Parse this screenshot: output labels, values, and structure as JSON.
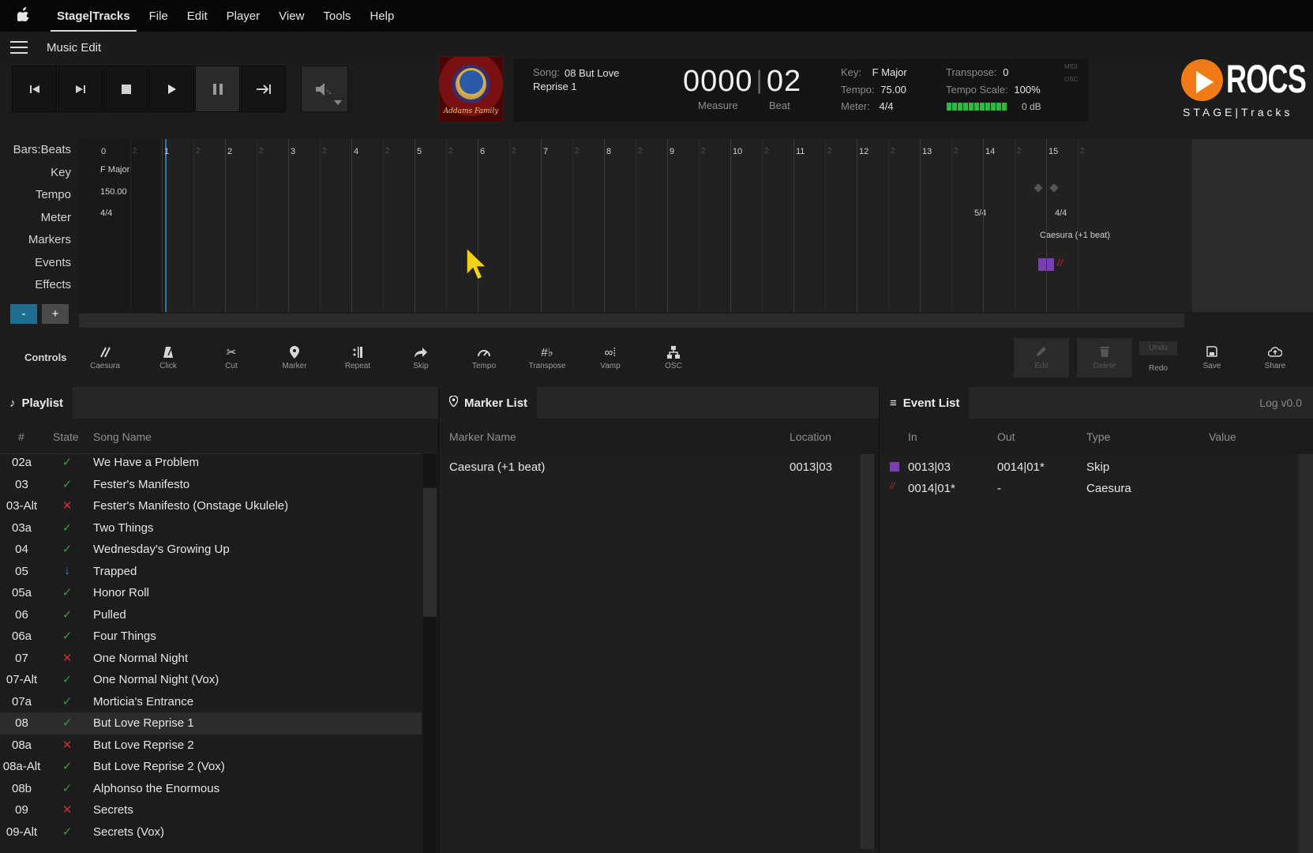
{
  "menubar": {
    "apple": "",
    "app_name": "Stage|Tracks",
    "items": [
      "File",
      "Edit",
      "Player",
      "View",
      "Tools",
      "Help"
    ]
  },
  "titlebar": {
    "title": "Music Edit"
  },
  "album": {
    "script_text": "Addams Family"
  },
  "info": {
    "song_label": "Song:",
    "song_name": "08 But Love Reprise 1",
    "measure": "0000",
    "beat": "02",
    "measure_label": "Measure",
    "beat_label": "Beat",
    "key_label": "Key:",
    "key": "F Major",
    "tempo_label": "Tempo:",
    "tempo": "75.00",
    "meter_label": "Meter:",
    "meter": "4/4",
    "transpose_label": "Transpose:",
    "transpose": "0",
    "tempo_scale_label": "Tempo Scale:",
    "tempo_scale": "100%",
    "level_db": "0 dB",
    "midi": "MIDI",
    "osc": "OSC",
    "level_meter_colors": [
      "#2cbb3a"
    ]
  },
  "logo": {
    "word": "ROCS",
    "sub": "STAGE|Tracks",
    "accent": "#f07a13"
  },
  "timeline": {
    "row_labels": [
      "Bars:Beats",
      "Key",
      "Tempo",
      "Meter",
      "Markers",
      "Events",
      "Effects"
    ],
    "bars": [
      "0",
      "1",
      "2",
      "3",
      "4",
      "5",
      "6",
      "7",
      "8",
      "9",
      "10",
      "11",
      "12",
      "13",
      "14",
      "15"
    ],
    "beat_tick": "2",
    "key_value": "F Major",
    "tempo_value": "150.00",
    "meter_start": "4/4",
    "meter_change_1": "5/4",
    "meter_change_2": "4/4",
    "marker_label": "Caesura (+1 beat)",
    "event_slash": "//",
    "zoom_minus": "-",
    "zoom_plus": "+",
    "playhead_color": "#2f73b8",
    "event_color": "#7a3eb0"
  },
  "controls": {
    "label": "Controls",
    "tools": [
      {
        "icon": "caesura-icon",
        "label": "Caesura"
      },
      {
        "icon": "metronome-icon",
        "label": "Click"
      },
      {
        "icon": "scissors-icon",
        "label": "Cut"
      },
      {
        "icon": "map-pin-icon",
        "label": "Marker"
      },
      {
        "icon": "repeat-icon",
        "label": "Repeat"
      },
      {
        "icon": "skip-arrow-icon",
        "label": "Skip"
      },
      {
        "icon": "gauge-icon",
        "label": "Tempo"
      },
      {
        "icon": "sharp-flat-icon",
        "label": "Transpose"
      },
      {
        "icon": "vamp-icon",
        "label": "Vamp"
      },
      {
        "icon": "network-icon",
        "label": "OSC"
      }
    ],
    "edit_label": "Edit",
    "delete_label": "Delete",
    "undo_label": "Undo",
    "redo_label": "Redo",
    "save_label": "Save",
    "share_label": "Share"
  },
  "playlist": {
    "title": "Playlist",
    "columns": [
      "#",
      "State",
      "Song Name"
    ],
    "rows": [
      {
        "num": "02a",
        "state": "ok",
        "name": "We Have a Problem"
      },
      {
        "num": "03",
        "state": "ok",
        "name": "Fester's Manifesto"
      },
      {
        "num": "03-Alt",
        "state": "x",
        "name": "Fester's Manifesto (Onstage Ukulele)"
      },
      {
        "num": "03a",
        "state": "ok",
        "name": "Two Things"
      },
      {
        "num": "04",
        "state": "ok",
        "name": "Wednesday's Growing Up"
      },
      {
        "num": "05",
        "state": "down",
        "name": "Trapped"
      },
      {
        "num": "05a",
        "state": "ok",
        "name": "Honor Roll"
      },
      {
        "num": "06",
        "state": "ok",
        "name": "Pulled"
      },
      {
        "num": "06a",
        "state": "ok",
        "name": "Four Things"
      },
      {
        "num": "07",
        "state": "x",
        "name": "One Normal Night"
      },
      {
        "num": "07-Alt",
        "state": "ok",
        "name": "One Normal Night (Vox)"
      },
      {
        "num": "07a",
        "state": "ok",
        "name": "Morticia's Entrance"
      },
      {
        "num": "08",
        "state": "ok",
        "name": "But Love Reprise 1",
        "selected": true
      },
      {
        "num": "08a",
        "state": "x",
        "name": "But Love Reprise 2"
      },
      {
        "num": "08a-Alt",
        "state": "ok",
        "name": "But Love Reprise 2 (Vox)"
      },
      {
        "num": "08b",
        "state": "ok",
        "name": "Alphonso the Enormous"
      },
      {
        "num": "09",
        "state": "x",
        "name": "Secrets"
      },
      {
        "num": "09-Alt",
        "state": "ok",
        "name": "Secrets (Vox)"
      }
    ]
  },
  "marker_list": {
    "title": "Marker List",
    "columns": [
      "Marker Name",
      "Location"
    ],
    "rows": [
      {
        "name": "Caesura (+1 beat)",
        "location": "0013|03"
      }
    ]
  },
  "event_list": {
    "title": "Event List",
    "log": "Log v0.0",
    "columns": [
      "In",
      "Out",
      "Type",
      "Value"
    ],
    "rows": [
      {
        "marker": "square",
        "in": "0013|03",
        "out": "0014|01*",
        "type": "Skip",
        "value": ""
      },
      {
        "marker": "slash",
        "in": "0014|01*",
        "out": "-",
        "type": "Caesura",
        "value": ""
      }
    ]
  }
}
